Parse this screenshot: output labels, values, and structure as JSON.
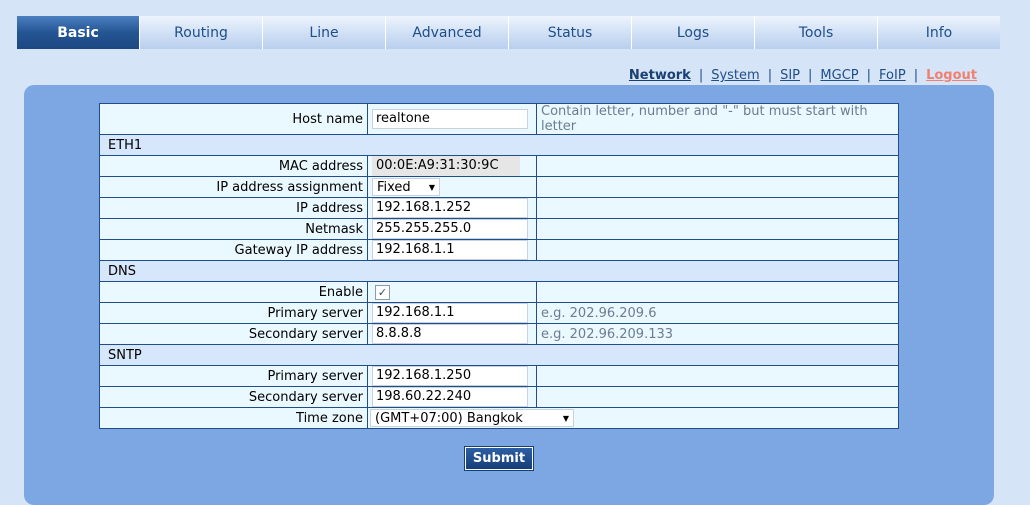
{
  "tabs": [
    {
      "label": "Basic",
      "active": true
    },
    {
      "label": "Routing"
    },
    {
      "label": "Line"
    },
    {
      "label": "Advanced"
    },
    {
      "label": "Status"
    },
    {
      "label": "Logs"
    },
    {
      "label": "Tools"
    },
    {
      "label": "Info"
    }
  ],
  "subnav": {
    "network": "Network",
    "system": "System",
    "sip": "SIP",
    "mgcp": "MGCP",
    "foip": "FoIP",
    "logout": "Logout",
    "separator": "|"
  },
  "form": {
    "host_name": {
      "label": "Host name",
      "value": "realtone",
      "hint": "Contain letter, number and \"-\" but must start with letter"
    },
    "eth1": {
      "title": "ETH1",
      "mac": {
        "label": "MAC address",
        "value": "00:0E:A9:31:30:9C"
      },
      "assignment": {
        "label": "IP address assignment",
        "value": "Fixed"
      },
      "ip": {
        "label": "IP address",
        "value": "192.168.1.252"
      },
      "netmask": {
        "label": "Netmask",
        "value": "255.255.255.0"
      },
      "gateway": {
        "label": "Gateway IP address",
        "value": "192.168.1.1"
      }
    },
    "dns": {
      "title": "DNS",
      "enable": {
        "label": "Enable",
        "checked": true
      },
      "primary": {
        "label": "Primary server",
        "value": "192.168.1.1",
        "hint": "e.g. 202.96.209.6"
      },
      "secondary": {
        "label": "Secondary server",
        "value": "8.8.8.8",
        "hint": "e.g. 202.96.209.133"
      }
    },
    "sntp": {
      "title": "SNTP",
      "primary": {
        "label": "Primary server",
        "value": "192.168.1.250"
      },
      "secondary": {
        "label": "Secondary server",
        "value": "198.60.22.240"
      },
      "timezone": {
        "label": "Time zone",
        "value": "(GMT+07:00) Bangkok"
      }
    }
  },
  "submit_label": "Submit",
  "icons": {
    "dropdown": "chevron-down-icon",
    "check": "checkmark-icon"
  },
  "colors": {
    "tab_active": "#245593",
    "panel": "#7da7e2",
    "background": "#d6e4f7",
    "logout": "#f08070"
  }
}
